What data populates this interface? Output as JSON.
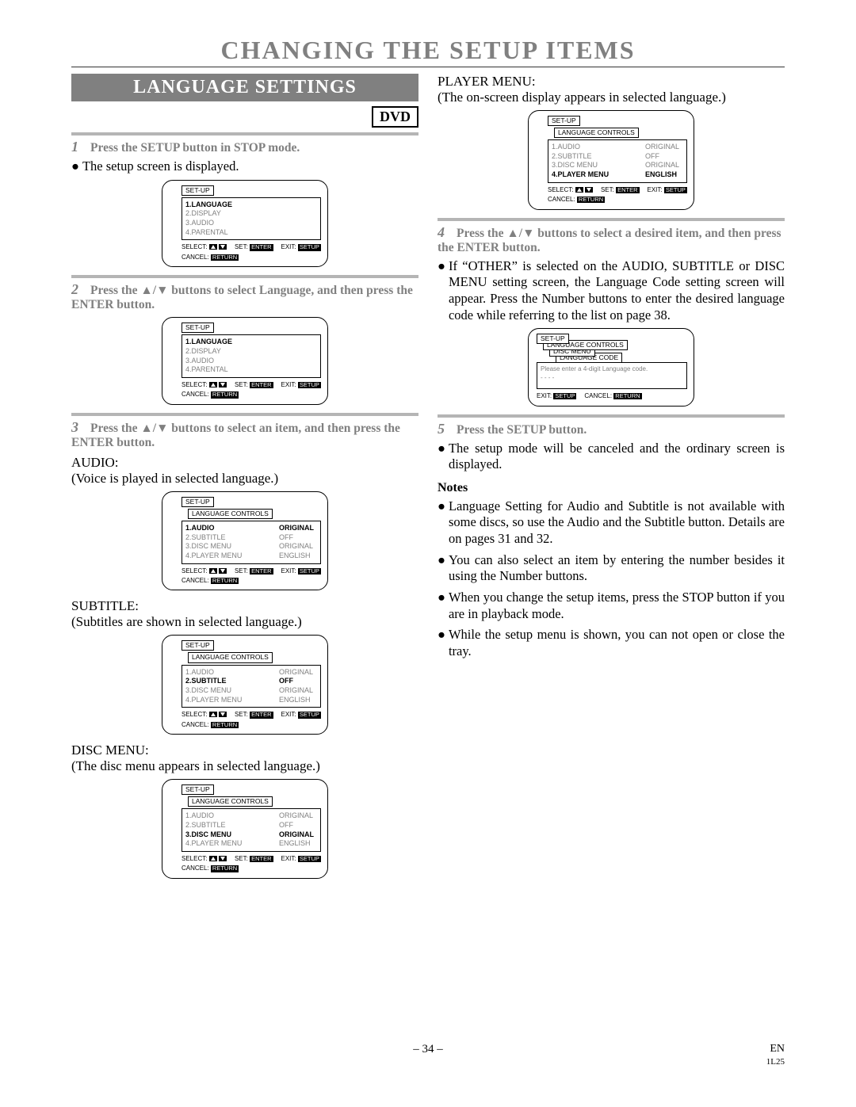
{
  "title": "CHANGING THE SETUP ITEMS",
  "section_header": "LANGUAGE SETTINGS",
  "dvd_badge": "DVD",
  "left": {
    "step1": "Press the SETUP button in STOP mode.",
    "step1_bullet": "The setup screen is displayed.",
    "step2": "Press the ▲/▼ buttons to select Language, and then press the ENTER button.",
    "step3": "Press the ▲/▼ buttons to select an item, and then press the ENTER button.",
    "audio_label": "AUDIO:",
    "audio_desc": "(Voice is played in selected language.)",
    "subtitle_label": "SUBTITLE:",
    "subtitle_desc": "(Subtitles are shown in selected language.)",
    "disc_label": "DISC MENU:",
    "disc_desc": "(The disc menu appears in selected language.)"
  },
  "right": {
    "player_label": "PLAYER MENU:",
    "player_desc": "(The on-screen display appears in selected language.)",
    "step4": "Press the ▲/▼ buttons to select a desired item, and then press the ENTER button.",
    "step4_bullet": "If “OTHER” is selected on the AUDIO, SUBTITLE or DISC MENU setting screen, the Language Code setting screen will appear. Press the Number buttons to enter the desired language code while referring to the list on page 38.",
    "step5": "Press the SETUP button.",
    "step5_bullet": "The setup mode will be canceled and the ordinary screen is displayed.",
    "notes_head": "Notes",
    "notes": [
      "Language Setting for Audio and Subtitle is not available with some discs, so use the Audio and the Subtitle button. Details are on pages 31 and 32.",
      "You can also select an item by entering the number besides it using the Number buttons.",
      "When you change the setup items, press the STOP button if you are in playback mode.",
      "While the setup menu is shown, you can not open or close the tray."
    ]
  },
  "osd": {
    "setup": "SET-UP",
    "lang_controls": "LANGUAGE CONTROLS",
    "disc_menu_tab": "DISC MENU",
    "lang_code_tab": "LANGUAGE CODE",
    "code_prompt": "Please enter a 4-digit Language code.",
    "code_dashes": "- - - -",
    "root_items": [
      "1.LANGUAGE",
      "2.DISPLAY",
      "3.AUDIO",
      "4.PARENTAL"
    ],
    "lang_items": [
      {
        "k": "1.AUDIO",
        "v": "ORIGINAL"
      },
      {
        "k": "2.SUBTITLE",
        "v": "OFF"
      },
      {
        "k": "3.DISC MENU",
        "v": "ORIGINAL"
      },
      {
        "k": "4.PLAYER MENU",
        "v": "ENGLISH"
      }
    ],
    "foot": {
      "select": "SELECT:",
      "set": "SET:",
      "exit": "EXIT:",
      "cancel": "CANCEL:",
      "enter": "ENTER",
      "setup": "SETUP",
      "return": "RETURN"
    }
  },
  "footer": {
    "page": "– 34 –",
    "lang": "EN",
    "code": "1L25"
  }
}
